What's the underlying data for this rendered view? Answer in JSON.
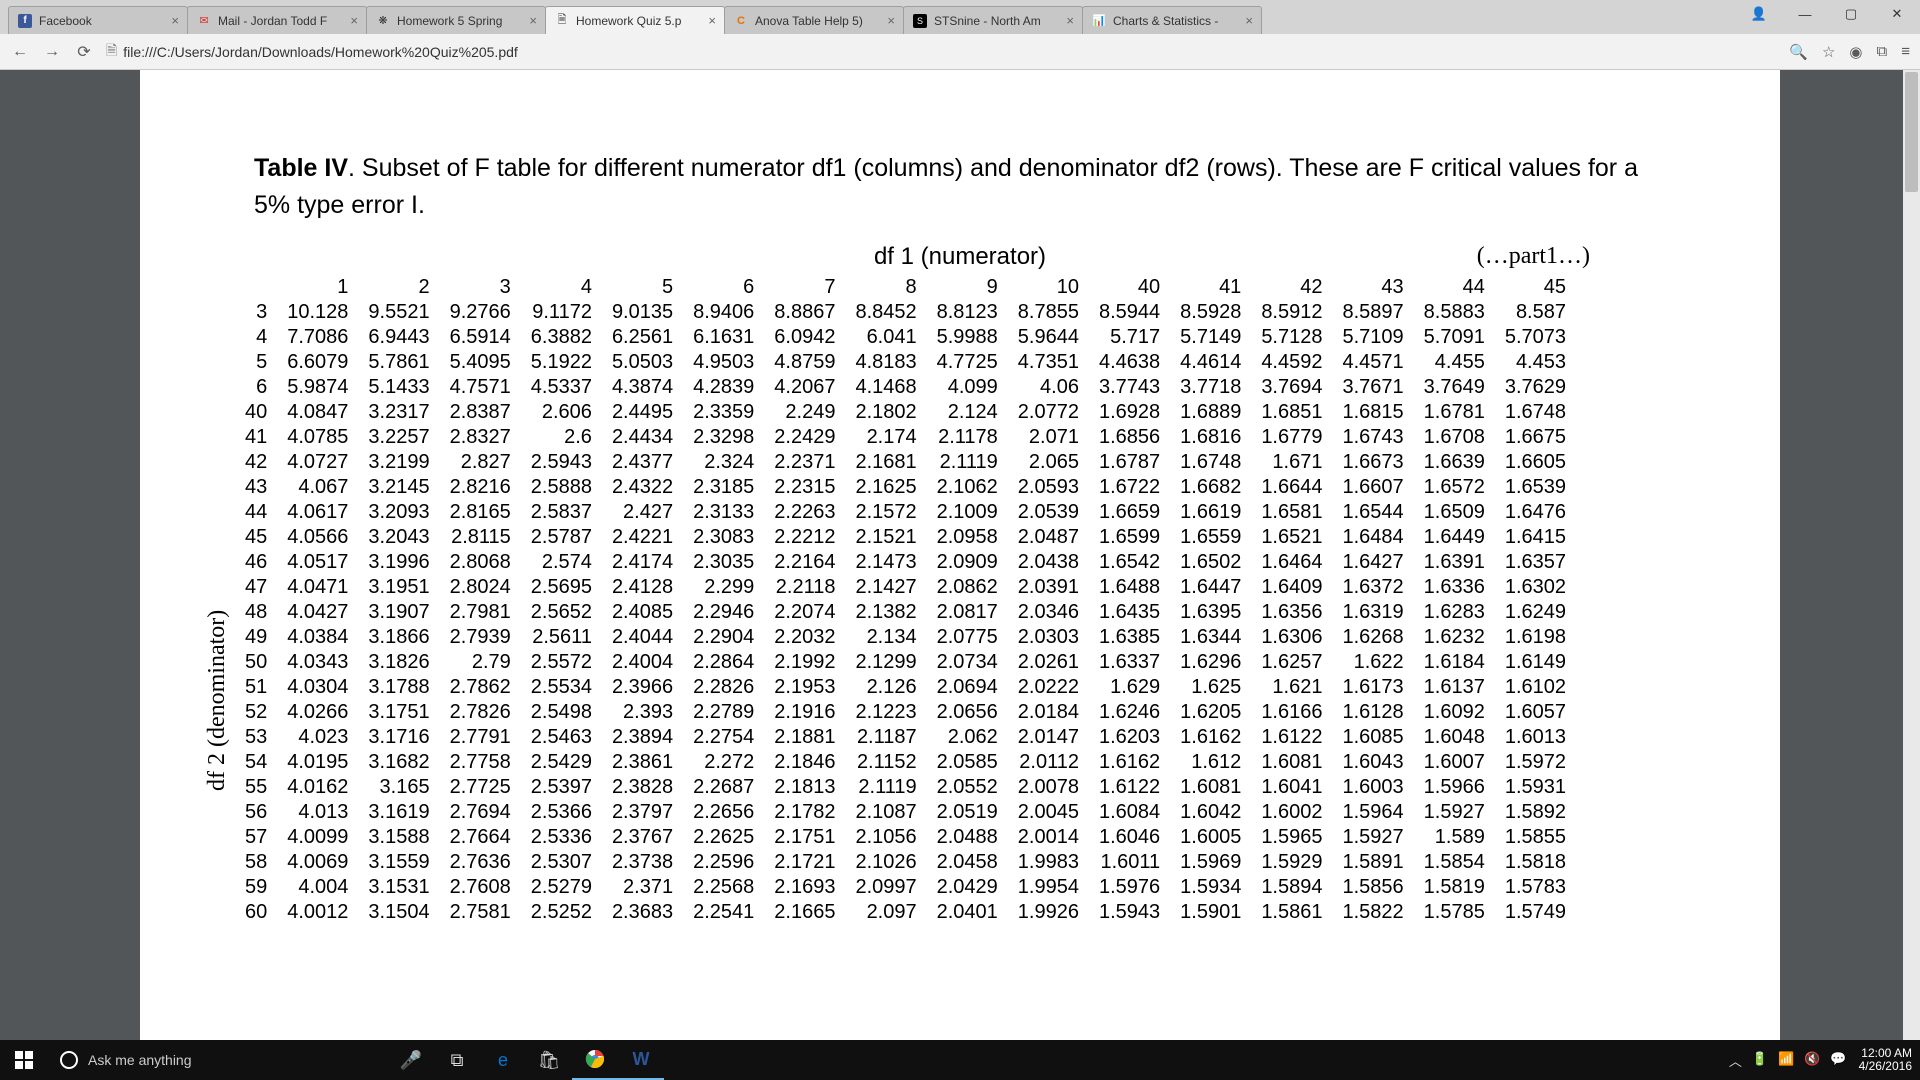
{
  "tabs": [
    {
      "title": "Facebook"
    },
    {
      "title": "Mail - Jordan Todd F"
    },
    {
      "title": "Homework 5 Spring"
    },
    {
      "title": "Homework Quiz 5.p"
    },
    {
      "title": "Anova Table Help 5)"
    },
    {
      "title": "STSnine - North Am"
    },
    {
      "title": "Charts & Statistics -"
    }
  ],
  "url": "file:///C:/Users/Jordan/Downloads/Homework%20Quiz%205.pdf",
  "caption_label": "Table IV",
  "caption_text": ". Subset of F table for different numerator df1 (columns) and denominator df2 (rows). These are F critical values for a 5% type error I.",
  "axis_top": "df 1 (numerator)",
  "axis_left": "df 2 (denominator)",
  "part_label": "(…part1…)",
  "chart_data": {
    "type": "table",
    "columns": [
      "1",
      "2",
      "3",
      "4",
      "5",
      "6",
      "7",
      "8",
      "9",
      "10",
      "40",
      "41",
      "42",
      "43",
      "44",
      "45"
    ],
    "row_labels": [
      "3",
      "4",
      "5",
      "6",
      "40",
      "41",
      "42",
      "43",
      "44",
      "45",
      "46",
      "47",
      "48",
      "49",
      "50",
      "51",
      "52",
      "53",
      "54",
      "55",
      "56",
      "57",
      "58",
      "59",
      "60"
    ],
    "rows": [
      [
        "10.128",
        "9.5521",
        "9.2766",
        "9.1172",
        "9.0135",
        "8.9406",
        "8.8867",
        "8.8452",
        "8.8123",
        "8.7855",
        "8.5944",
        "8.5928",
        "8.5912",
        "8.5897",
        "8.5883",
        "8.587"
      ],
      [
        "7.7086",
        "6.9443",
        "6.5914",
        "6.3882",
        "6.2561",
        "6.1631",
        "6.0942",
        "6.041",
        "5.9988",
        "5.9644",
        "5.717",
        "5.7149",
        "5.7128",
        "5.7109",
        "5.7091",
        "5.7073"
      ],
      [
        "6.6079",
        "5.7861",
        "5.4095",
        "5.1922",
        "5.0503",
        "4.9503",
        "4.8759",
        "4.8183",
        "4.7725",
        "4.7351",
        "4.4638",
        "4.4614",
        "4.4592",
        "4.4571",
        "4.455",
        "4.453"
      ],
      [
        "5.9874",
        "5.1433",
        "4.7571",
        "4.5337",
        "4.3874",
        "4.2839",
        "4.2067",
        "4.1468",
        "4.099",
        "4.06",
        "3.7743",
        "3.7718",
        "3.7694",
        "3.7671",
        "3.7649",
        "3.7629"
      ],
      [
        "4.0847",
        "3.2317",
        "2.8387",
        "2.606",
        "2.4495",
        "2.3359",
        "2.249",
        "2.1802",
        "2.124",
        "2.0772",
        "1.6928",
        "1.6889",
        "1.6851",
        "1.6815",
        "1.6781",
        "1.6748"
      ],
      [
        "4.0785",
        "3.2257",
        "2.8327",
        "2.6",
        "2.4434",
        "2.3298",
        "2.2429",
        "2.174",
        "2.1178",
        "2.071",
        "1.6856",
        "1.6816",
        "1.6779",
        "1.6743",
        "1.6708",
        "1.6675"
      ],
      [
        "4.0727",
        "3.2199",
        "2.827",
        "2.5943",
        "2.4377",
        "2.324",
        "2.2371",
        "2.1681",
        "2.1119",
        "2.065",
        "1.6787",
        "1.6748",
        "1.671",
        "1.6673",
        "1.6639",
        "1.6605"
      ],
      [
        "4.067",
        "3.2145",
        "2.8216",
        "2.5888",
        "2.4322",
        "2.3185",
        "2.2315",
        "2.1625",
        "2.1062",
        "2.0593",
        "1.6722",
        "1.6682",
        "1.6644",
        "1.6607",
        "1.6572",
        "1.6539"
      ],
      [
        "4.0617",
        "3.2093",
        "2.8165",
        "2.5837",
        "2.427",
        "2.3133",
        "2.2263",
        "2.1572",
        "2.1009",
        "2.0539",
        "1.6659",
        "1.6619",
        "1.6581",
        "1.6544",
        "1.6509",
        "1.6476"
      ],
      [
        "4.0566",
        "3.2043",
        "2.8115",
        "2.5787",
        "2.4221",
        "2.3083",
        "2.2212",
        "2.1521",
        "2.0958",
        "2.0487",
        "1.6599",
        "1.6559",
        "1.6521",
        "1.6484",
        "1.6449",
        "1.6415"
      ],
      [
        "4.0517",
        "3.1996",
        "2.8068",
        "2.574",
        "2.4174",
        "2.3035",
        "2.2164",
        "2.1473",
        "2.0909",
        "2.0438",
        "1.6542",
        "1.6502",
        "1.6464",
        "1.6427",
        "1.6391",
        "1.6357"
      ],
      [
        "4.0471",
        "3.1951",
        "2.8024",
        "2.5695",
        "2.4128",
        "2.299",
        "2.2118",
        "2.1427",
        "2.0862",
        "2.0391",
        "1.6488",
        "1.6447",
        "1.6409",
        "1.6372",
        "1.6336",
        "1.6302"
      ],
      [
        "4.0427",
        "3.1907",
        "2.7981",
        "2.5652",
        "2.4085",
        "2.2946",
        "2.2074",
        "2.1382",
        "2.0817",
        "2.0346",
        "1.6435",
        "1.6395",
        "1.6356",
        "1.6319",
        "1.6283",
        "1.6249"
      ],
      [
        "4.0384",
        "3.1866",
        "2.7939",
        "2.5611",
        "2.4044",
        "2.2904",
        "2.2032",
        "2.134",
        "2.0775",
        "2.0303",
        "1.6385",
        "1.6344",
        "1.6306",
        "1.6268",
        "1.6232",
        "1.6198"
      ],
      [
        "4.0343",
        "3.1826",
        "2.79",
        "2.5572",
        "2.4004",
        "2.2864",
        "2.1992",
        "2.1299",
        "2.0734",
        "2.0261",
        "1.6337",
        "1.6296",
        "1.6257",
        "1.622",
        "1.6184",
        "1.6149"
      ],
      [
        "4.0304",
        "3.1788",
        "2.7862",
        "2.5534",
        "2.3966",
        "2.2826",
        "2.1953",
        "2.126",
        "2.0694",
        "2.0222",
        "1.629",
        "1.625",
        "1.621",
        "1.6173",
        "1.6137",
        "1.6102"
      ],
      [
        "4.0266",
        "3.1751",
        "2.7826",
        "2.5498",
        "2.393",
        "2.2789",
        "2.1916",
        "2.1223",
        "2.0656",
        "2.0184",
        "1.6246",
        "1.6205",
        "1.6166",
        "1.6128",
        "1.6092",
        "1.6057"
      ],
      [
        "4.023",
        "3.1716",
        "2.7791",
        "2.5463",
        "2.3894",
        "2.2754",
        "2.1881",
        "2.1187",
        "2.062",
        "2.0147",
        "1.6203",
        "1.6162",
        "1.6122",
        "1.6085",
        "1.6048",
        "1.6013"
      ],
      [
        "4.0195",
        "3.1682",
        "2.7758",
        "2.5429",
        "2.3861",
        "2.272",
        "2.1846",
        "2.1152",
        "2.0585",
        "2.0112",
        "1.6162",
        "1.612",
        "1.6081",
        "1.6043",
        "1.6007",
        "1.5972"
      ],
      [
        "4.0162",
        "3.165",
        "2.7725",
        "2.5397",
        "2.3828",
        "2.2687",
        "2.1813",
        "2.1119",
        "2.0552",
        "2.0078",
        "1.6122",
        "1.6081",
        "1.6041",
        "1.6003",
        "1.5966",
        "1.5931"
      ],
      [
        "4.013",
        "3.1619",
        "2.7694",
        "2.5366",
        "2.3797",
        "2.2656",
        "2.1782",
        "2.1087",
        "2.0519",
        "2.0045",
        "1.6084",
        "1.6042",
        "1.6002",
        "1.5964",
        "1.5927",
        "1.5892"
      ],
      [
        "4.0099",
        "3.1588",
        "2.7664",
        "2.5336",
        "2.3767",
        "2.2625",
        "2.1751",
        "2.1056",
        "2.0488",
        "2.0014",
        "1.6046",
        "1.6005",
        "1.5965",
        "1.5927",
        "1.589",
        "1.5855"
      ],
      [
        "4.0069",
        "3.1559",
        "2.7636",
        "2.5307",
        "2.3738",
        "2.2596",
        "2.1721",
        "2.1026",
        "2.0458",
        "1.9983",
        "1.6011",
        "1.5969",
        "1.5929",
        "1.5891",
        "1.5854",
        "1.5818"
      ],
      [
        "4.004",
        "3.1531",
        "2.7608",
        "2.5279",
        "2.371",
        "2.2568",
        "2.1693",
        "2.0997",
        "2.0429",
        "1.9954",
        "1.5976",
        "1.5934",
        "1.5894",
        "1.5856",
        "1.5819",
        "1.5783"
      ],
      [
        "4.0012",
        "3.1504",
        "2.7581",
        "2.5252",
        "2.3683",
        "2.2541",
        "2.1665",
        "2.097",
        "2.0401",
        "1.9926",
        "1.5943",
        "1.5901",
        "1.5861",
        "1.5822",
        "1.5785",
        "1.5749"
      ]
    ]
  },
  "search_placeholder": "Ask me anything",
  "clock": {
    "time": "12:00 AM",
    "date": "4/26/2016"
  }
}
